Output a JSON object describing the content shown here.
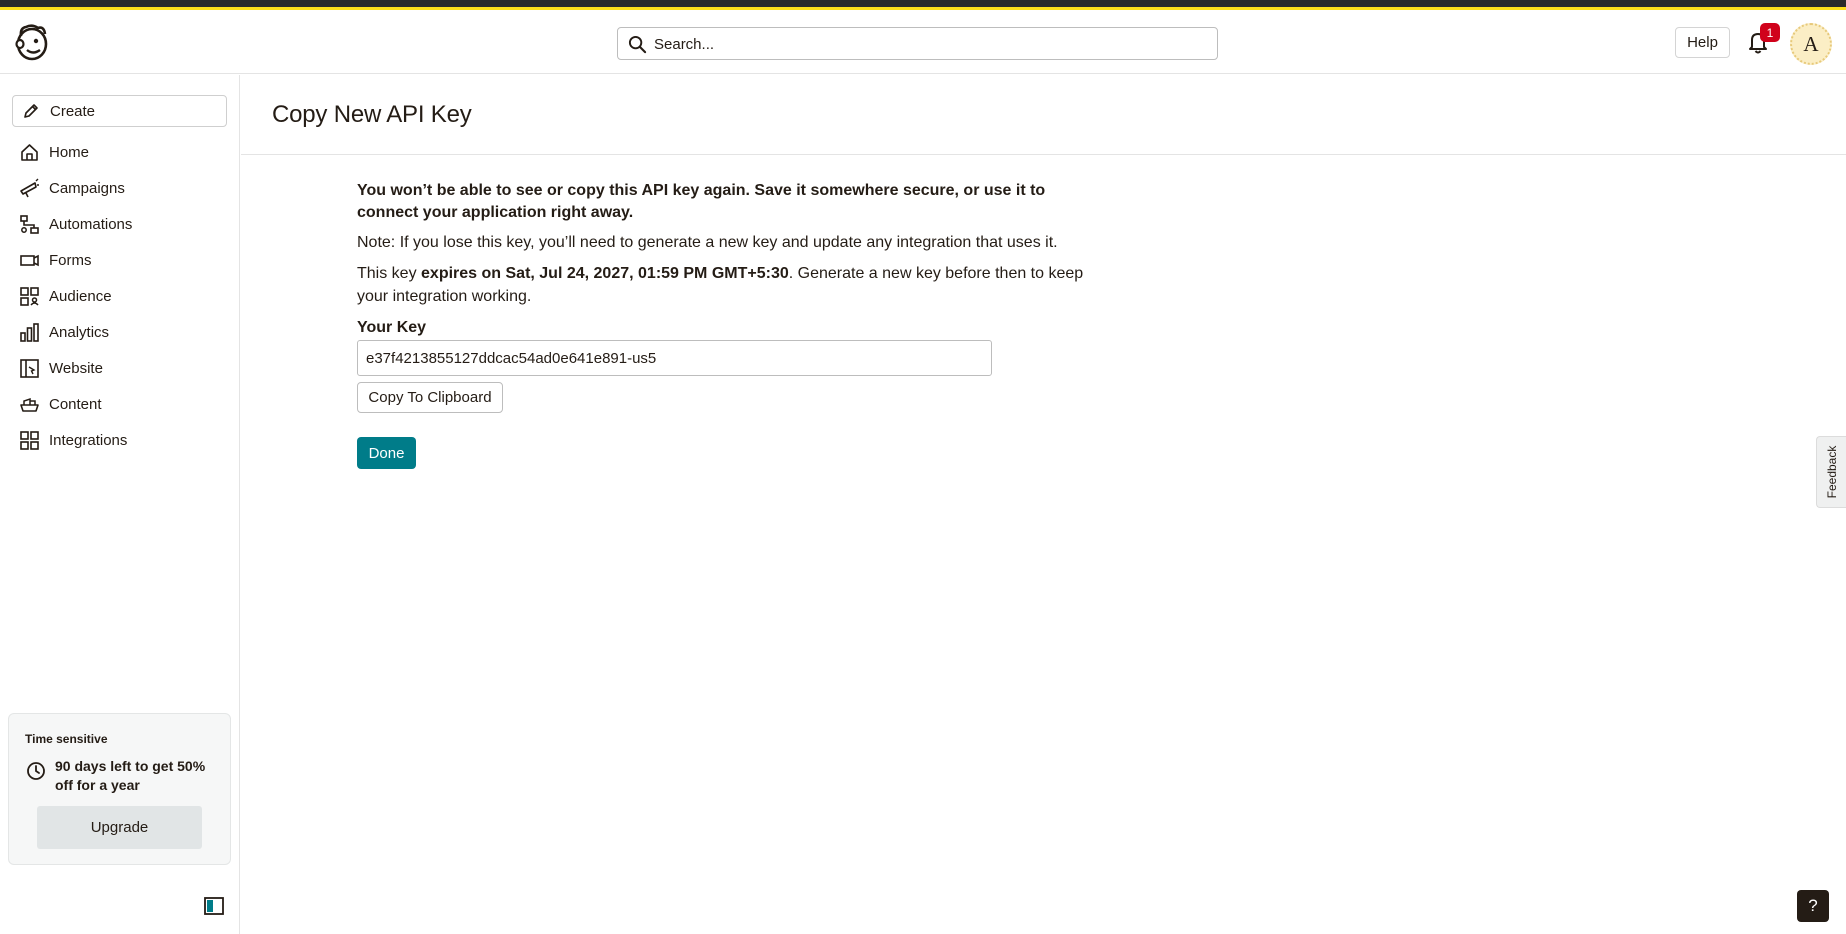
{
  "header": {
    "logo_icon": "mailchimp-freddie-logo",
    "search_placeholder": "Search...",
    "help_label": "Help",
    "notification_count": "1",
    "avatar_initial": "A"
  },
  "sidebar": {
    "create_label": "Create",
    "items": [
      {
        "label": "Home",
        "icon": "home-icon"
      },
      {
        "label": "Campaigns",
        "icon": "megaphone-icon"
      },
      {
        "label": "Automations",
        "icon": "automation-icon"
      },
      {
        "label": "Forms",
        "icon": "forms-icon"
      },
      {
        "label": "Audience",
        "icon": "audience-icon"
      },
      {
        "label": "Analytics",
        "icon": "analytics-icon"
      },
      {
        "label": "Website",
        "icon": "website-icon"
      },
      {
        "label": "Content",
        "icon": "content-icon"
      },
      {
        "label": "Integrations",
        "icon": "integrations-icon"
      }
    ],
    "promo": {
      "tag": "Time sensitive",
      "message": "90 days left to get 50% off for a year",
      "button_label": "Upgrade"
    }
  },
  "page": {
    "title": "Copy New API Key",
    "warning": "You won’t be able to see or copy this API key again. Save it somewhere secure, or use it to connect your application right away.",
    "note": "Note: If you lose this key, you’ll need to generate a new key and update any integration that uses it.",
    "expiry_prefix": "This key ",
    "expiry_bold": "expires on Sat, Jul 24, 2027, 01:59 PM GMT+5:30",
    "expiry_suffix": ". Generate a new key before then to keep your integration working.",
    "key_label": "Your Key",
    "key_value": "e37f4213855127ddcac54ad0e641e891-us5",
    "copy_label": "Copy To Clipboard",
    "done_label": "Done"
  },
  "feedback_label": "Feedback",
  "help_fab_label": "?",
  "colors": {
    "accent": "#007c89",
    "brand_yellow": "#ffe01b",
    "badge": "#d0021b",
    "text": "#241c15"
  }
}
